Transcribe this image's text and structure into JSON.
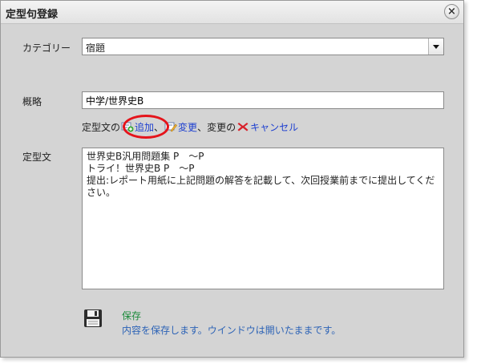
{
  "dialog": {
    "title": "定型句登録",
    "close_glyph": "×"
  },
  "form": {
    "category": {
      "label": "カテゴリー",
      "value": "宿題"
    },
    "summary": {
      "label": "概略",
      "value": "中学/世界史B"
    },
    "actions": {
      "prefix": "定型文の",
      "add_label": "追加",
      "sep1": "、",
      "change_label": "変更",
      "sep2": "、変更の",
      "cancel_label": "キャンセル"
    },
    "template": {
      "label": "定型文",
      "value": "世界史B汎用問題集 P　～P\nトライ！世界史B P　～P\n提出:レポート用紙に上記問題の解答を記載して、次回授業前までに提出してください。"
    }
  },
  "footer": {
    "save_label": "保存",
    "save_description": "内容を保存します。ウインドウは開いたままです。"
  },
  "colors": {
    "link": "#1d3fd0",
    "highlight_ring": "#e5141b",
    "save_label": "#1a8a3a",
    "save_desc": "#2d63b6"
  },
  "icons": [
    "close-icon",
    "dropdown-arrow-icon",
    "add-icon",
    "edit-icon",
    "cancel-x-icon",
    "floppy-disk-icon"
  ]
}
